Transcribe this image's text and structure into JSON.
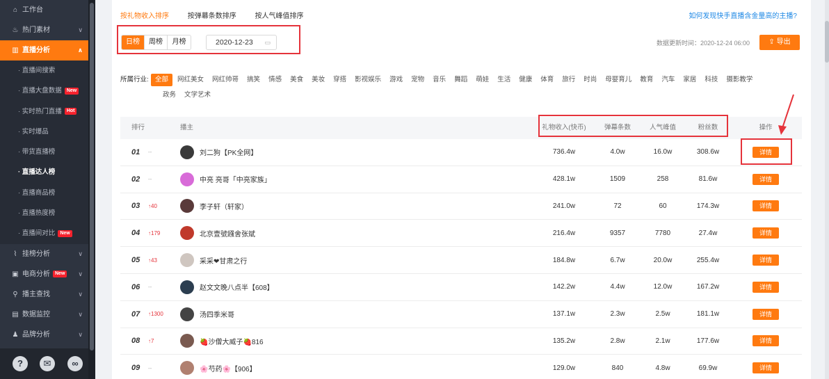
{
  "sidebar": {
    "items": [
      {
        "icon": "home-icon",
        "glyph": "⌂",
        "label": "工作台"
      },
      {
        "icon": "fire-icon",
        "glyph": "♨",
        "label": "热门素材",
        "chevron": "∨"
      },
      {
        "icon": "bar-chart-icon",
        "glyph": "▥",
        "label": "直播分析",
        "chevron": "∧",
        "active": true
      }
    ],
    "subitems": [
      {
        "label": "直播间搜索"
      },
      {
        "label": "直播大盘数据",
        "badge": "New"
      },
      {
        "label": "实时热门直播",
        "badge": "Hot"
      },
      {
        "label": "实时爆品"
      },
      {
        "label": "带货直播榜"
      },
      {
        "label": "直播达人榜",
        "current": true
      },
      {
        "label": "直播商品榜"
      },
      {
        "label": "直播热度榜"
      },
      {
        "label": "直播间对比",
        "badge": "New"
      }
    ],
    "items2": [
      {
        "icon": "trend-icon",
        "glyph": "⌇",
        "label": "挂榜分析",
        "chevron": "∨"
      },
      {
        "icon": "shop-icon",
        "glyph": "▣",
        "label": "电商分析",
        "badge": "New",
        "chevron": "∨"
      },
      {
        "icon": "search-icon",
        "glyph": "⚲",
        "label": "播主查找",
        "chevron": "∨"
      },
      {
        "icon": "monitor-icon",
        "glyph": "▤",
        "label": "数据监控",
        "chevron": "∨"
      },
      {
        "icon": "brand-icon",
        "glyph": "♟",
        "label": "品牌分析",
        "chevron": "∨"
      }
    ],
    "bottom": {
      "help": "?",
      "wechat": "✉",
      "link": "∞"
    }
  },
  "tabs": [
    "按礼物收入排序",
    "按弹幕条数排序",
    "按人气峰值排序"
  ],
  "tabs_link": "如何发现快手直播含金量高的主播?",
  "period": [
    "日榜",
    "周榜",
    "月榜"
  ],
  "date": "2020-12-23",
  "update_time": "数据更新时间：2020-12-24 06:00",
  "export_label": "导出",
  "industry": {
    "label": "所属行业:",
    "row1": [
      "全部",
      "网红美女",
      "网红帅哥",
      "搞笑",
      "情感",
      "美食",
      "美妆",
      "穿搭",
      "影视娱乐",
      "游戏",
      "宠物",
      "音乐",
      "舞蹈",
      "萌娃",
      "生活",
      "健康",
      "体育",
      "旅行",
      "时尚",
      "母婴育儿",
      "教育",
      "汽车",
      "家居",
      "科技",
      "摄影教学"
    ],
    "row2": [
      "政务",
      "文学艺术"
    ]
  },
  "table": {
    "headers": {
      "rank": "排行",
      "name": "播主",
      "gift": "礼物收入(快币)",
      "danmu": "弹幕条数",
      "peak": "人气峰值",
      "fans": "粉丝数",
      "op": "操作"
    },
    "rows": [
      {
        "rank": "01",
        "trend": "--",
        "up": false,
        "name": "刘二狗【PK全网】",
        "gift": "736.4w",
        "danmu": "4.0w",
        "peak": "16.0w",
        "fans": "308.6w",
        "color": "#3a3a3a"
      },
      {
        "rank": "02",
        "trend": "--",
        "up": false,
        "name": "中亮 亮哥「中亮家族」",
        "gift": "428.1w",
        "danmu": "1509",
        "peak": "258",
        "fans": "81.6w",
        "color": "#d86bd8"
      },
      {
        "rank": "03",
        "trend": "↑40",
        "up": true,
        "name": "李子轩（轩家）",
        "gift": "241.0w",
        "danmu": "72",
        "peak": "60",
        "fans": "174.3w",
        "color": "#5a3a3a"
      },
      {
        "rank": "04",
        "trend": "↑179",
        "up": true,
        "name": "北京壹號鏹舍张斌",
        "gift": "216.4w",
        "danmu": "9357",
        "peak": "7780",
        "fans": "27.4w",
        "color": "#c0392b"
      },
      {
        "rank": "05",
        "trend": "↑43",
        "up": true,
        "name": "采采❤甘肃之行",
        "gift": "184.8w",
        "danmu": "6.7w",
        "peak": "20.0w",
        "fans": "255.4w",
        "color": "#cfc6c0"
      },
      {
        "rank": "06",
        "trend": "--",
        "up": false,
        "name": "赵文文晚八点半【608】",
        "gift": "142.2w",
        "danmu": "4.4w",
        "peak": "12.0w",
        "fans": "167.2w",
        "color": "#2c3e50"
      },
      {
        "rank": "07",
        "trend": "↑1300",
        "up": true,
        "name": "汤四季米哥",
        "gift": "137.1w",
        "danmu": "2.3w",
        "peak": "2.5w",
        "fans": "181.1w",
        "color": "#444"
      },
      {
        "rank": "08",
        "trend": "↑7",
        "up": true,
        "name": "🍓沙僧大威子🍓816",
        "gift": "135.2w",
        "danmu": "2.8w",
        "peak": "2.1w",
        "fans": "177.6w",
        "color": "#7a5a50"
      },
      {
        "rank": "09",
        "trend": "--",
        "up": false,
        "name": "🌸芍药🌸【906】",
        "gift": "129.0w",
        "danmu": "840",
        "peak": "4.8w",
        "fans": "69.9w",
        "color": "#b08070"
      }
    ],
    "detail_label": "详情"
  },
  "colors": {
    "accent": "#ff7a10",
    "annotation": "#e5333b",
    "link": "#1e88e5",
    "sidebar": "#2e3440"
  }
}
